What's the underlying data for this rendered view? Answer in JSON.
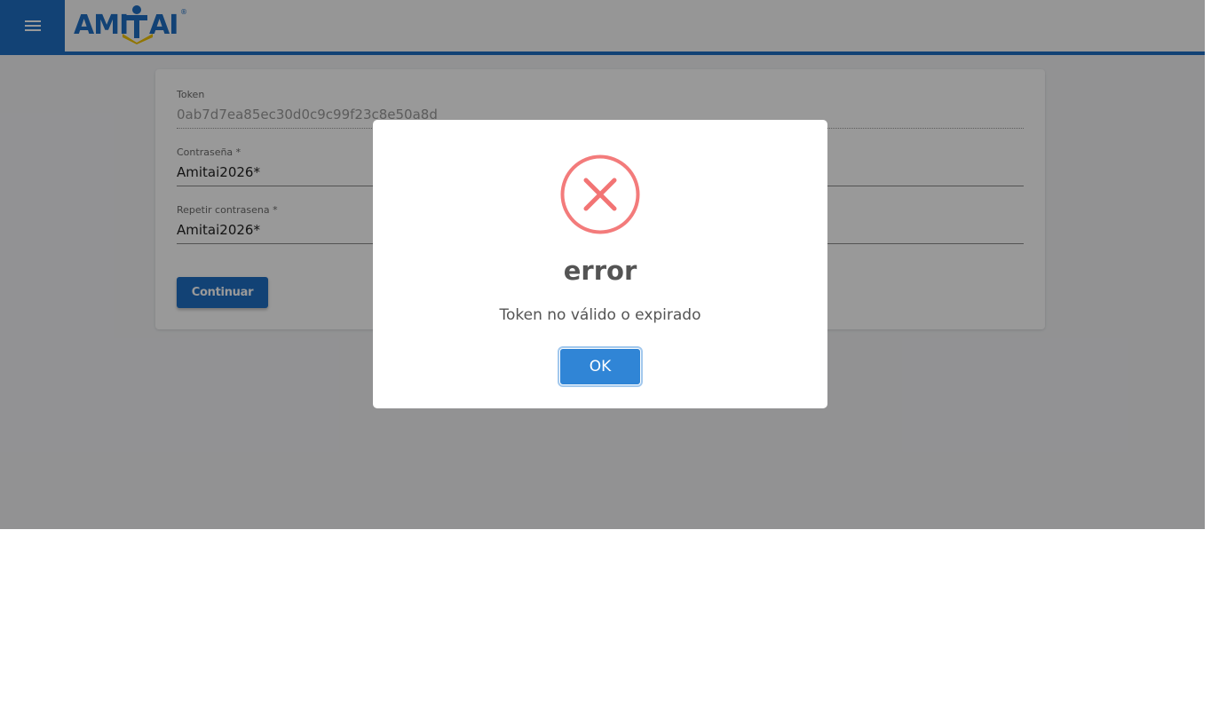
{
  "header": {
    "logo_text": "AMITAI",
    "logo_mark": "®",
    "menu_icon": "hamburger-menu-icon",
    "accent_color": "#1e6fc4"
  },
  "form": {
    "token": {
      "label": "Token",
      "value": "0ab7d7ea85ec30d0c9c99f23c8e50a8d"
    },
    "password": {
      "label": "Contraseña *",
      "value": "Amitai2026*"
    },
    "repeat_password": {
      "label": "Repetir contrasena *",
      "value": "Amitai2026*"
    },
    "submit_label": "Continuar"
  },
  "dialog": {
    "icon": "error-x-icon",
    "icon_color": "#f27474",
    "title": "error",
    "message": "Token no válido o expirado",
    "confirm_label": "OK",
    "confirm_color": "#3085d6"
  }
}
